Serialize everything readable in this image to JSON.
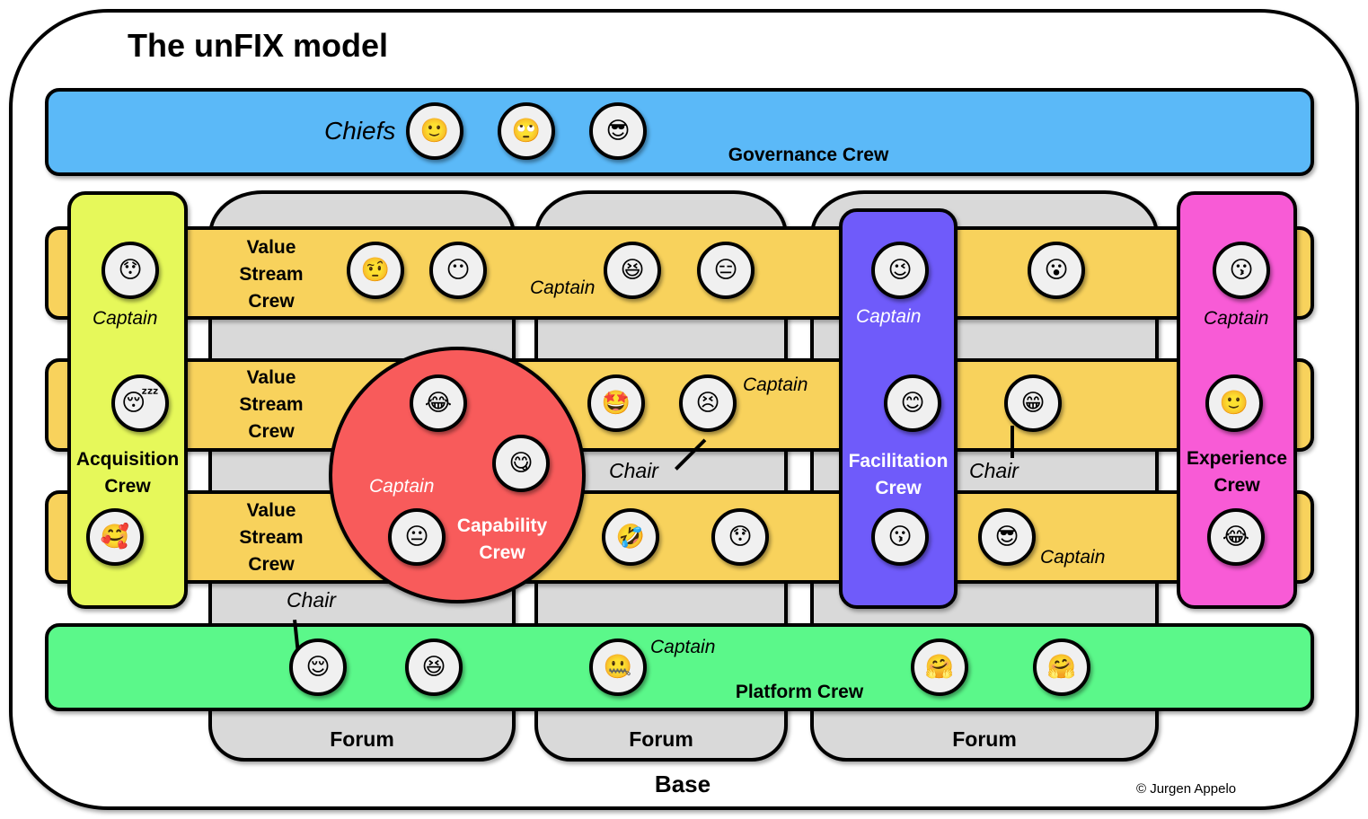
{
  "title": "The unFIX model",
  "governance": {
    "label": "Governance Crew",
    "role": "Chiefs",
    "color": "#5bb9f8",
    "members": [
      "🙂",
      "🙄",
      "😎"
    ]
  },
  "forums": [
    {
      "label": "Forum"
    },
    {
      "label": "Forum"
    },
    {
      "label": "Forum"
    }
  ],
  "value_streams": [
    {
      "label_lines": [
        "Value",
        "Stream",
        "Crew"
      ],
      "members": [
        "🤨",
        "😶",
        "😆",
        "😑",
        "😮"
      ],
      "captain_label": "Captain"
    },
    {
      "label_lines": [
        "Value",
        "Stream",
        "Crew"
      ],
      "members": [
        "🤩",
        "😣",
        "😁"
      ],
      "captain_label": "Captain",
      "chair_labels": [
        "Chair",
        "Chair"
      ]
    },
    {
      "label_lines": [
        "Value",
        "Stream",
        "Crew"
      ],
      "members": [
        "🤣",
        "😯",
        "😎"
      ],
      "captain_label": "Captain"
    }
  ],
  "acquisition": {
    "label_lines": [
      "Acquisition",
      "Crew"
    ],
    "role": "Captain",
    "color": "#e6f85a",
    "members": [
      "😯",
      "😴",
      "🥰"
    ]
  },
  "capability": {
    "label_lines": [
      "Capability",
      "Crew"
    ],
    "role": "Captain",
    "color": "#f85b5b",
    "members": [
      "😂",
      "😋",
      "😐"
    ]
  },
  "facilitation": {
    "label_lines": [
      "Facilitation",
      "Crew"
    ],
    "role": "Captain",
    "color": "#6f5bfa",
    "members": [
      "😉",
      "😊",
      "😗"
    ]
  },
  "experience": {
    "label_lines": [
      "Experience",
      "Crew"
    ],
    "role": "Captain",
    "color": "#f85bd6",
    "members": [
      "😗",
      "🙂",
      "😂"
    ]
  },
  "platform": {
    "label": "Platform Crew",
    "role_captain": "Captain",
    "role_chair": "Chair",
    "color": "#5bf88a",
    "members": [
      "😌",
      "😆",
      "🤐",
      "🤗",
      "🤗"
    ]
  },
  "base_label": "Base",
  "copyright": "© Jurgen Appelo"
}
